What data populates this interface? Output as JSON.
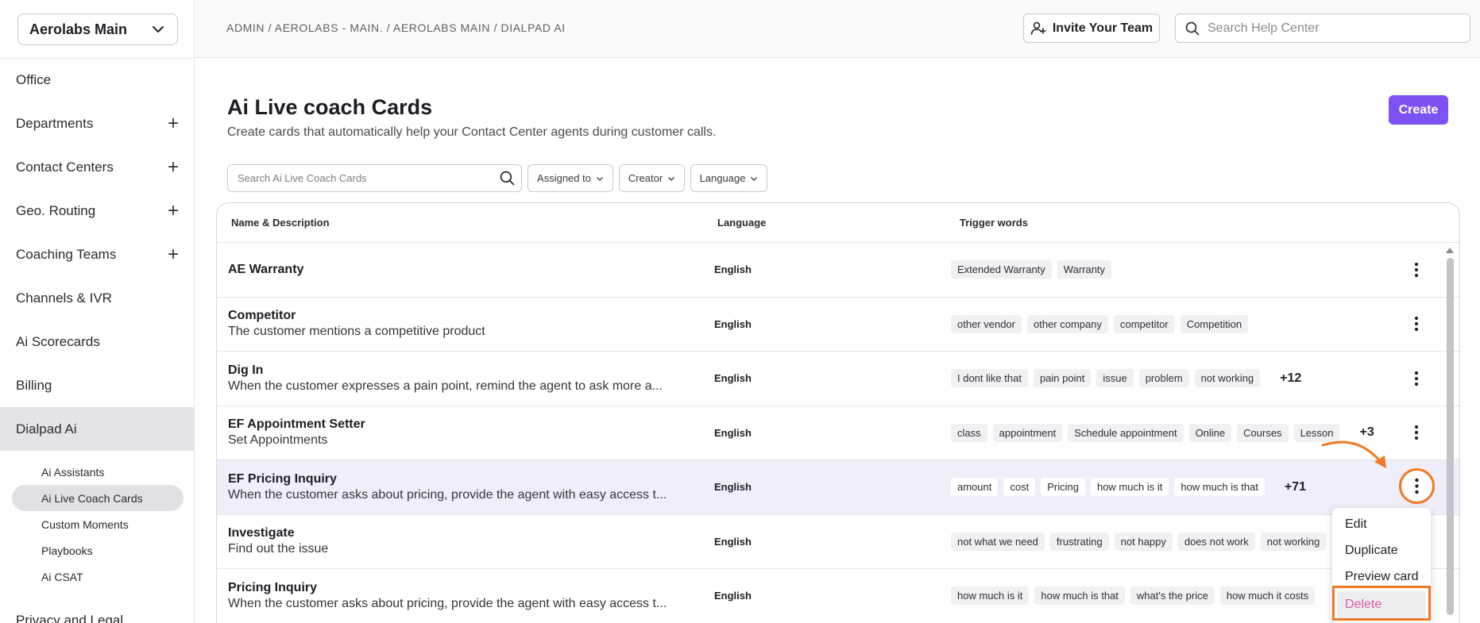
{
  "workspace": {
    "selected": "Aerolabs Main"
  },
  "sidebar": {
    "items": [
      {
        "label": "Office",
        "expandable": false
      },
      {
        "label": "Departments",
        "expandable": true
      },
      {
        "label": "Contact Centers",
        "expandable": true
      },
      {
        "label": "Geo. Routing",
        "expandable": true
      },
      {
        "label": "Coaching Teams",
        "expandable": true
      },
      {
        "label": "Channels & IVR",
        "expandable": false
      },
      {
        "label": "Ai Scorecards",
        "expandable": false
      },
      {
        "label": "Billing",
        "expandable": false
      },
      {
        "label": "Dialpad Ai",
        "expandable": false,
        "active": true
      }
    ],
    "sub_items": [
      {
        "label": "Ai Assistants"
      },
      {
        "label": "Ai Live Coach Cards",
        "active": true
      },
      {
        "label": "Custom Moments"
      },
      {
        "label": "Playbooks"
      },
      {
        "label": "Ai CSAT"
      }
    ],
    "cut_item": "Privacy and Legal"
  },
  "header": {
    "breadcrumb": "ADMIN / AEROLABS - MAIN. / AEROLABS MAIN / DIALPAD AI",
    "invite_label": "Invite Your Team",
    "help_search_placeholder": "Search Help Center"
  },
  "page": {
    "title": "Ai Live coach Cards",
    "subtitle": "Create cards that automatically help your Contact Center agents during customer calls.",
    "create_label": "Create",
    "search_placeholder": "Search Ai Live Coach Cards",
    "filters": {
      "assigned": "Assigned to",
      "creator": "Creator",
      "language": "Language"
    }
  },
  "table": {
    "columns": {
      "name": "Name & Description",
      "language": "Language",
      "triggers": "Trigger words"
    },
    "rows": [
      {
        "name": "AE Warranty",
        "description": "",
        "language": "English",
        "triggers": [
          "Extended Warranty",
          "Warranty"
        ],
        "more": ""
      },
      {
        "name": "Competitor",
        "description": "The customer mentions a competitive product",
        "language": "English",
        "triggers": [
          "other vendor",
          "other company",
          "competitor",
          "Competition"
        ],
        "more": ""
      },
      {
        "name": "Dig In",
        "description": "When the customer expresses a pain point, remind the agent to ask more a...",
        "language": "English",
        "triggers": [
          "I dont like that",
          "pain point",
          "issue",
          "problem",
          "not working"
        ],
        "more": "+12"
      },
      {
        "name": "EF Appointment Setter",
        "description": "Set Appointments",
        "language": "English",
        "triggers": [
          "class",
          "appointment",
          "Schedule appointment",
          "Online",
          "Courses",
          "Lesson"
        ],
        "more": "+3"
      },
      {
        "name": "EF Pricing Inquiry",
        "description": "When the customer asks about pricing, provide the agent with easy access t...",
        "language": "English",
        "triggers": [
          "amount",
          "cost",
          "Pricing",
          "how much is it",
          "how much is that"
        ],
        "more": "+71",
        "highlighted": true
      },
      {
        "name": "Investigate",
        "description": "Find out the issue",
        "language": "English",
        "triggers": [
          "not what we need",
          "frustrating",
          "not happy",
          "does not work",
          "not working"
        ],
        "more": ""
      },
      {
        "name": "Pricing Inquiry",
        "description": "When the customer asks about pricing, provide the agent with easy access t...",
        "language": "English",
        "triggers": [
          "how much is it",
          "how much is that",
          "what's the price",
          "how much it costs"
        ],
        "more": ""
      }
    ]
  },
  "context_menu": {
    "edit": "Edit",
    "duplicate": "Duplicate",
    "preview": "Preview card",
    "delete": "Delete"
  },
  "colors": {
    "accent": "#7c52f2",
    "annotation": "#f07a24",
    "delete": "#e05aa5",
    "row_highlight": "#f1eefb"
  }
}
